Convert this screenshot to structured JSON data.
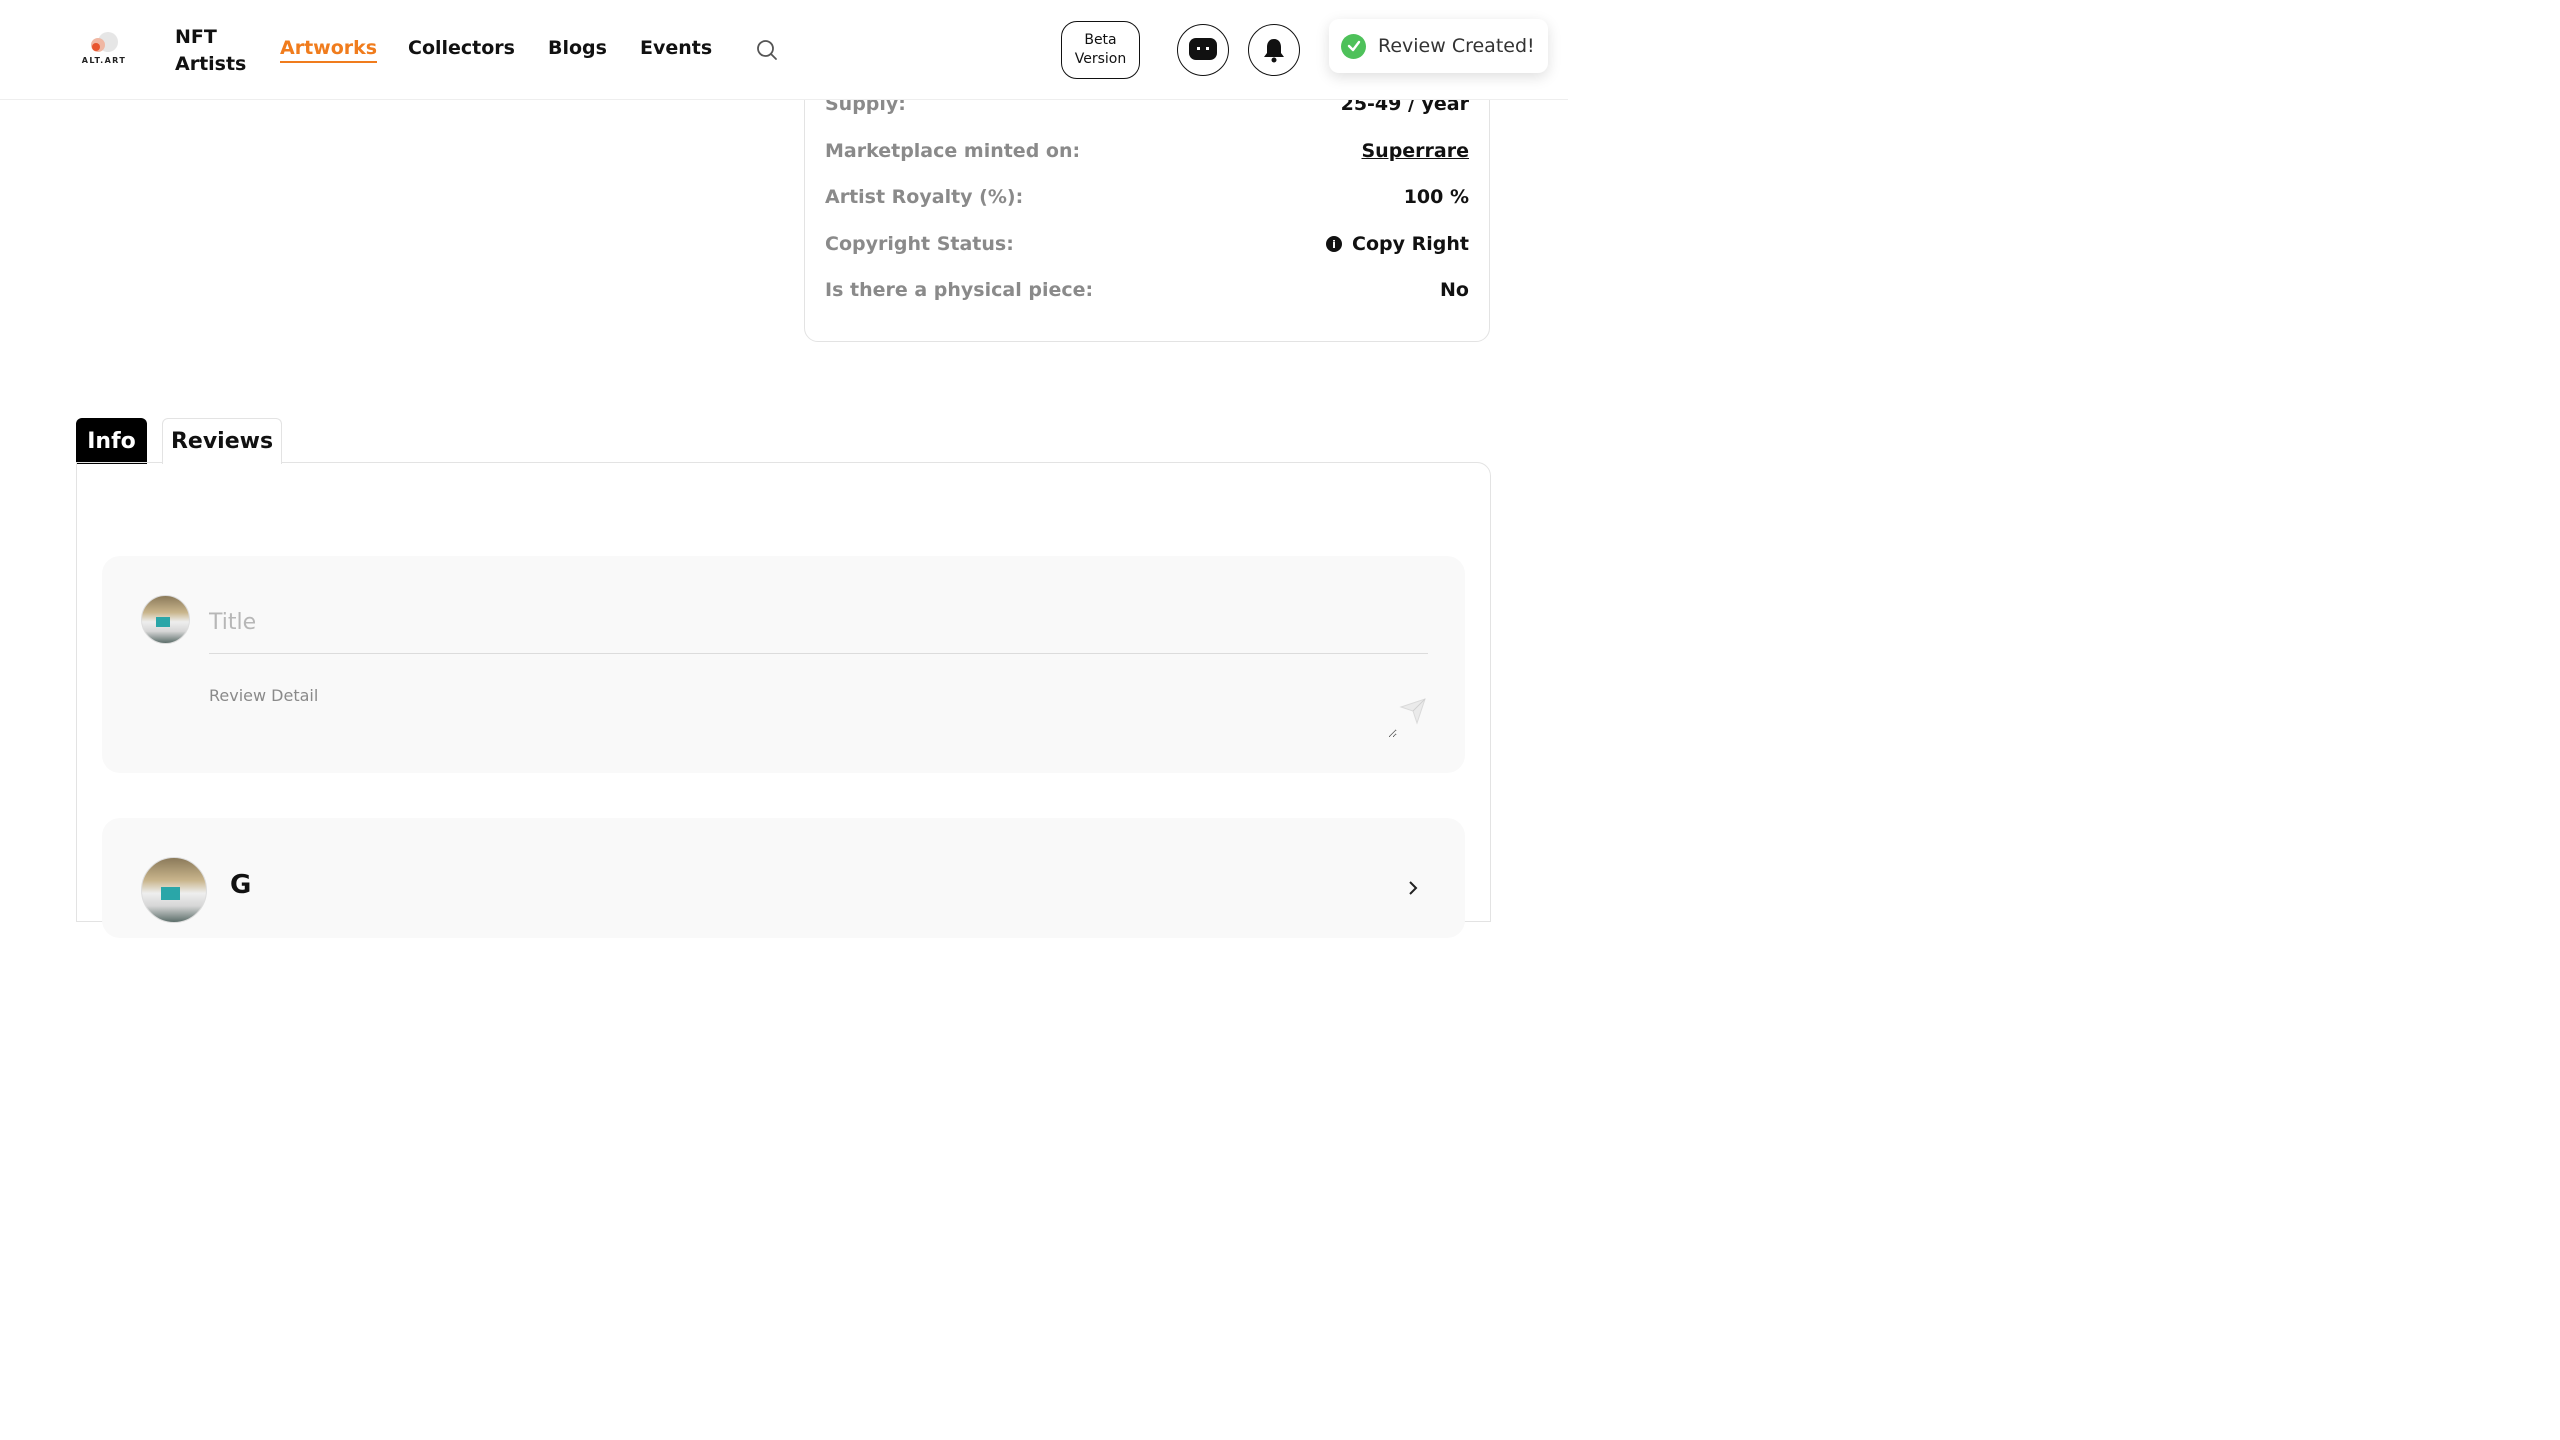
{
  "header": {
    "logo_text": "ALT.ART",
    "nav": {
      "nft_artists": "NFT Artists",
      "artworks": "Artworks",
      "collectors": "Collectors",
      "blogs": "Blogs",
      "events": "Events"
    },
    "beta_line1": "Beta",
    "beta_line2": "Version"
  },
  "toast": {
    "message": "Review Created!"
  },
  "details": {
    "supply_label": "Supply:",
    "supply_value": "25-49 / year",
    "marketplace_label": "Marketplace minted on:",
    "marketplace_value": "Superrare",
    "royalty_label": "Artist Royalty (%):",
    "royalty_value": "100 %",
    "copyright_label": "Copyright Status:",
    "copyright_value": "Copy Right",
    "physical_label": "Is there a physical piece:",
    "physical_value": "No"
  },
  "tabs": {
    "info": "Info",
    "reviews": "Reviews"
  },
  "review_form": {
    "title_placeholder": "Title",
    "detail_placeholder": "Review Detail"
  },
  "review_card": {
    "name_partial": "G"
  },
  "colors": {
    "accent": "#f07c1d",
    "success": "#4ec15a",
    "muted_label": "#8a8a8a",
    "panel_bg": "#f9f9f9"
  },
  "icons": [
    "search-icon",
    "chat-icon",
    "bell-icon",
    "check-icon",
    "info-icon",
    "send-icon",
    "chevron-icon"
  ]
}
